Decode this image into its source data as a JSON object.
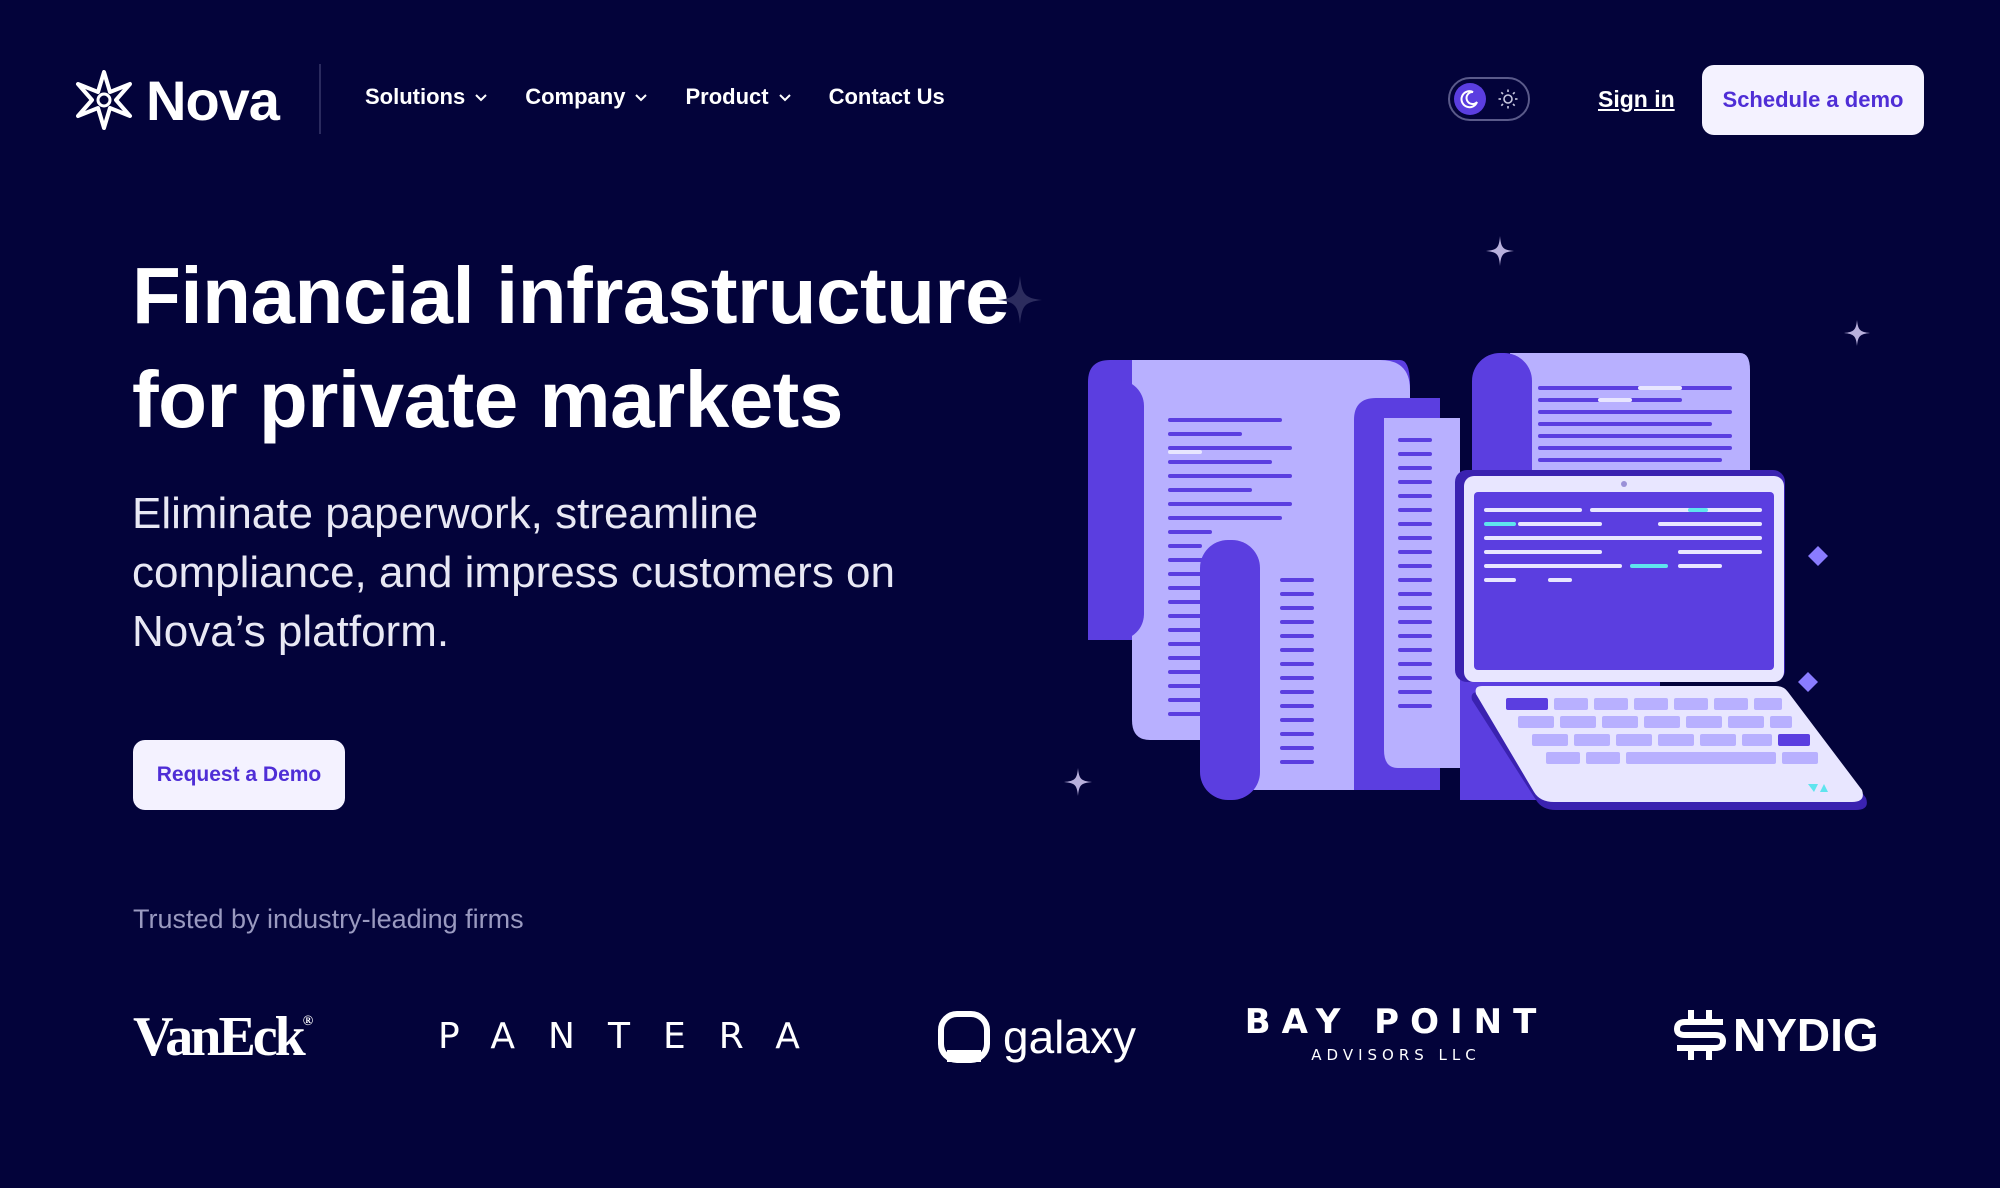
{
  "brand": {
    "name": "Nova"
  },
  "nav": {
    "items": [
      {
        "label": "Solutions",
        "has_dropdown": true
      },
      {
        "label": "Company",
        "has_dropdown": true
      },
      {
        "label": "Product",
        "has_dropdown": true
      },
      {
        "label": "Contact Us",
        "has_dropdown": false
      }
    ],
    "theme_toggle": {
      "selected": "dark",
      "icons": [
        "moon-icon",
        "sun-icon"
      ]
    },
    "sign_in_label": "Sign in",
    "schedule_label": "Schedule a demo"
  },
  "hero": {
    "title_line1": "Financial infrastructure",
    "title_line2": "for private markets",
    "subtitle": "Eliminate paperwork, streamline compliance, and impress customers on Nova’s platform.",
    "cta_label": "Request a Demo"
  },
  "trusted": {
    "label": "Trusted by industry-leading firms",
    "firms": {
      "vaneck": "VanEck",
      "vaneck_mark": "®",
      "pantera": "PANTERA",
      "galaxy": "galaxy",
      "baypoint_line1": "BAY POINT",
      "baypoint_line2": "ADVISORS LLC",
      "nydig": "NYDIG"
    }
  },
  "colors": {
    "background": "#03033a",
    "accent": "#5b3ee0",
    "button_bg": "#f4f2ff",
    "button_text": "#4f2ed6",
    "paper_light": "#b8b0ff",
    "paper_dark": "#5b3ee0"
  }
}
